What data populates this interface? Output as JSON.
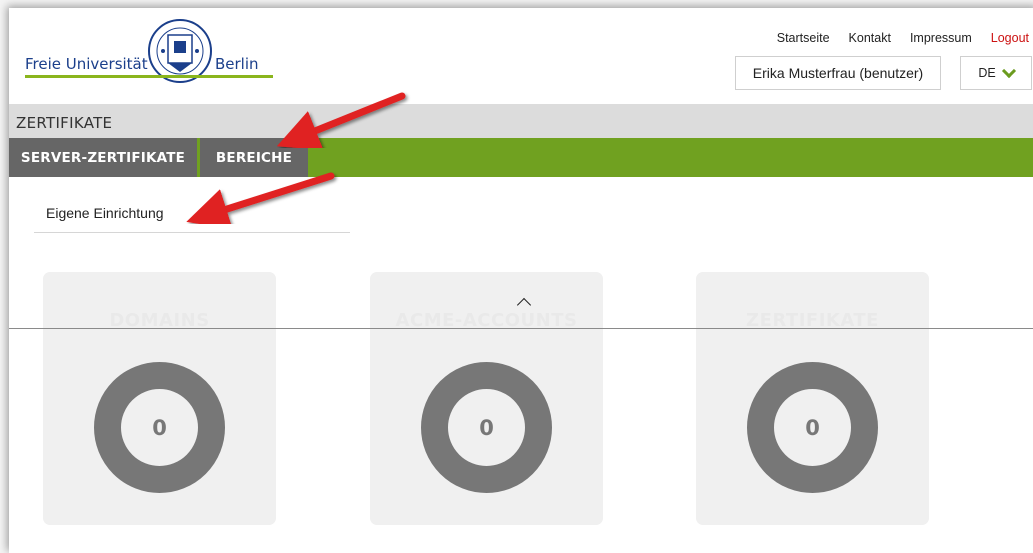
{
  "header": {
    "logo_left": "Freie Universität",
    "logo_right": "Berlin",
    "nav": [
      "Startseite",
      "Kontakt",
      "Impressum",
      "Logout"
    ],
    "user": "Erika Musterfrau (benutzer)",
    "language": "DE"
  },
  "section_title": "ZERTIFIKATE",
  "tabs": [
    "SERVER-ZERTIFIKATE",
    "BEREICHE"
  ],
  "subnav": {
    "item": "Eigene Einrichtung"
  },
  "cards": [
    {
      "title": "DOMAINS",
      "value": "0"
    },
    {
      "title": "ACME-ACCOUNTS",
      "value": "0"
    },
    {
      "title": "ZERTIFIKATE",
      "value": "0"
    }
  ],
  "colors": {
    "brand_green": "#70a120",
    "tab_gray": "#666666",
    "ring_gray": "#777777",
    "annotation_red": "#e02020",
    "logout_red": "#cc1111",
    "fu_blue": "#1b3f8b"
  },
  "icons": {
    "language_chevron": "chevron-down-icon",
    "collapse": "chevron-up-icon",
    "annotation": "red-arrow-icon"
  }
}
